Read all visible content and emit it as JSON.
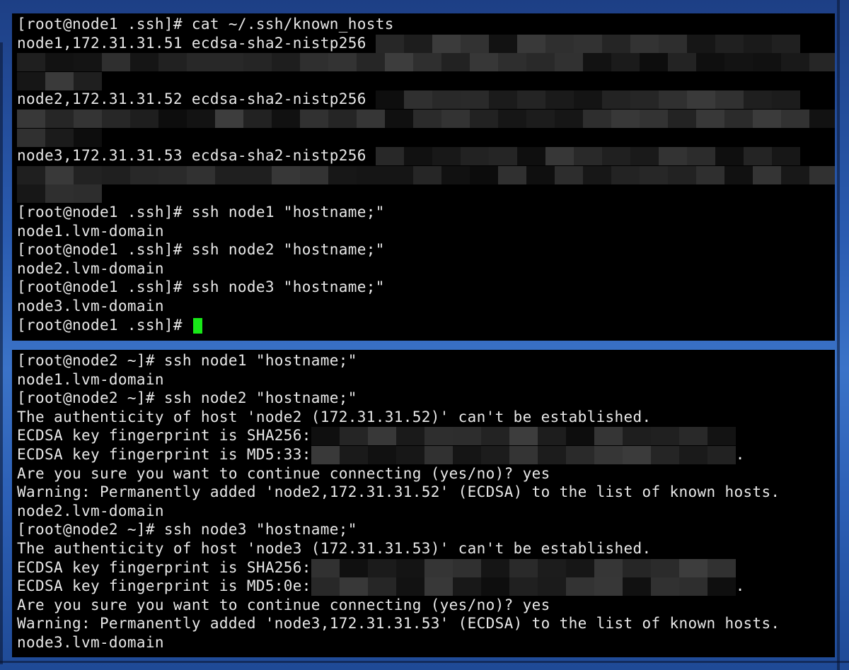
{
  "background": {
    "colors": [
      "#1d3f85",
      "#3b73c8"
    ]
  },
  "top_terminal": {
    "lines": {
      "l1": "[root@node1 .ssh]# cat ~/.ssh/known_hosts",
      "l2": "node1,172.31.31.51 ecdsa-sha2-nistp256 ",
      "l3": "node2,172.31.31.52 ecdsa-sha2-nistp256 ",
      "l4": "node3,172.31.31.53 ecdsa-sha2-nistp256 ",
      "l5": "[root@node1 .ssh]# ssh node1 \"hostname;\"",
      "l6": "node1.lvm-domain",
      "l7": "[root@node1 .ssh]# ssh node2 \"hostname;\"",
      "l8": "node2.lvm-domain",
      "l9": "[root@node1 .ssh]# ssh node3 \"hostname;\"",
      "l10": "node3.lvm-domain",
      "l11": "[root@node1 .ssh]# "
    },
    "cursor_color": "#18e818"
  },
  "bottom_terminal": {
    "lines": {
      "l1": "[root@node2 ~]# ssh node1 \"hostname;\"",
      "l2": "node1.lvm-domain",
      "l3": "[root@node2 ~]# ssh node2 \"hostname;\"",
      "l4": "The authenticity of host 'node2 (172.31.31.52)' can't be established.",
      "l5": "ECDSA key fingerprint is SHA256:",
      "l6": "ECDSA key fingerprint is MD5:33:",
      "l6_end": ".",
      "l7": "Are you sure you want to continue connecting (yes/no)? yes",
      "l8": "Warning: Permanently added 'node2,172.31.31.52' (ECDSA) to the list of known hosts.",
      "l9": "node2.lvm-domain",
      "l10": "[root@node2 ~]# ssh node3 \"hostname;\"",
      "l11": "The authenticity of host 'node3 (172.31.31.53)' can't be established.",
      "l12": "ECDSA key fingerprint is SHA256:",
      "l13": "ECDSA key fingerprint is MD5:0e:",
      "l13_end": ".",
      "l14": "Are you sure you want to continue connecting (yes/no)? yes",
      "l15": "Warning: Permanently added 'node3,172.31.31.53' (ECDSA) to the list of known hosts.",
      "l16": "node3.lvm-domain"
    }
  }
}
